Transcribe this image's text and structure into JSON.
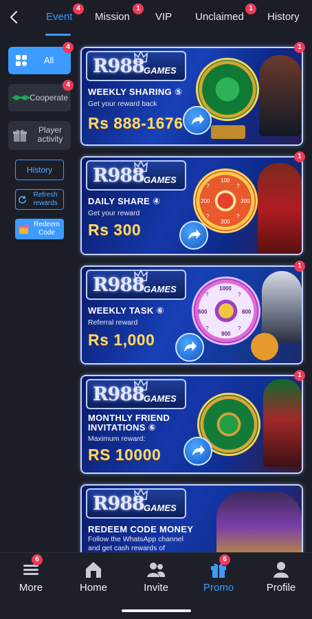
{
  "tabs": [
    {
      "label": "Event",
      "badge": "4",
      "active": true
    },
    {
      "label": "Mission",
      "badge": "1"
    },
    {
      "label": "VIP"
    },
    {
      "label": "Unclaimed",
      "badge": "1"
    },
    {
      "label": "History"
    }
  ],
  "sidebar": {
    "categories": [
      {
        "label": "All",
        "badge": "4",
        "active": true
      },
      {
        "label": "Cooperate",
        "badge": "4"
      },
      {
        "label": "Player activity"
      }
    ],
    "actions": {
      "history": "History",
      "refresh_rewards": "Refresh rewards",
      "redeem_code": "Redeem Code"
    }
  },
  "banners": [
    {
      "logo": "R988",
      "logo_suffix": "GAMES",
      "title": "WEEKLY SHARING ⑤",
      "subtitle": "Get your reward back",
      "amount": "Rs 888-1676",
      "badge": "1"
    },
    {
      "logo": "R988",
      "logo_suffix": "GAMES",
      "title": "DAILY SHARE ④",
      "subtitle": "Get your reward",
      "amount": "Rs 300",
      "badge": "1",
      "wheel_numbers": [
        "100",
        "?",
        "300",
        "?",
        "300",
        "?",
        "200",
        "?"
      ]
    },
    {
      "logo": "R988",
      "logo_suffix": "GAMES",
      "title": "WEEKLY TASK ⑥",
      "subtitle": "Referral reward",
      "amount": "Rs 1,000",
      "badge": "1",
      "wheel_numbers": [
        "1000",
        "?",
        "800",
        "?",
        "900",
        "?",
        "600",
        "?"
      ]
    },
    {
      "logo": "R988",
      "logo_suffix": "GAMES",
      "title_line1": "MONTHLY FRIEND",
      "title_line2": "INVITATIONS ⑥",
      "subtitle": "Maximum reward:",
      "amount": "RS 10000",
      "badge": "1"
    },
    {
      "logo": "R988",
      "logo_suffix": "GAMES",
      "title": "REDEEM CODE MONEY",
      "subtitle_line1": "Follow the WhatsApp channel",
      "subtitle_line2": "and get cash rewards of"
    }
  ],
  "bottom_nav": [
    {
      "label": "More",
      "badge": "6",
      "icon": "menu-icon"
    },
    {
      "label": "Home",
      "icon": "home-icon"
    },
    {
      "label": "Invite",
      "icon": "invite-icon"
    },
    {
      "label": "Promo",
      "badge": "6",
      "icon": "gift-icon",
      "active": true
    },
    {
      "label": "Profile",
      "icon": "profile-icon"
    }
  ],
  "colors": {
    "accent": "#3d9bff",
    "badge": "#ee3a58",
    "background": "#1b1e26",
    "amount": "#ffd96a"
  }
}
